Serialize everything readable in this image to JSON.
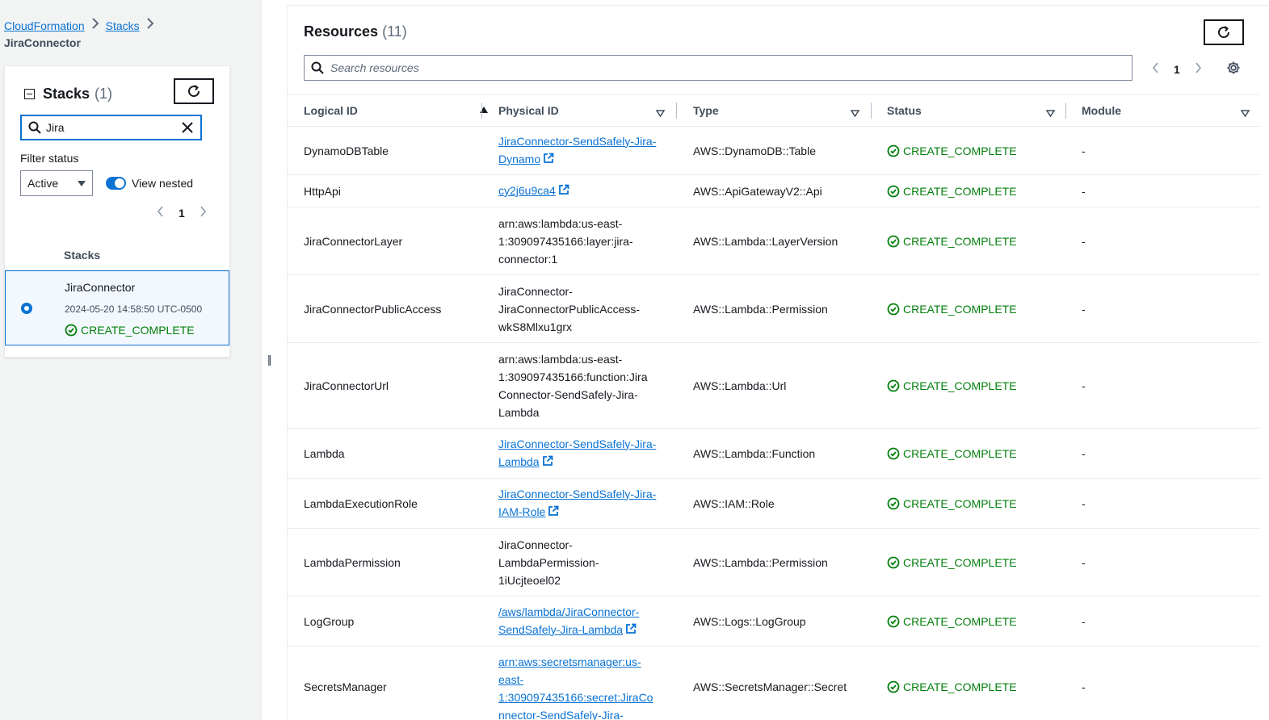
{
  "breadcrumb": {
    "root": "CloudFormation",
    "stacks": "Stacks",
    "current": "JiraConnector"
  },
  "stacks_panel": {
    "title": "Stacks",
    "count": "(1)",
    "search_value": "Jira",
    "filter_label": "Filter status",
    "filter_value": "Active",
    "toggle_label": "View nested",
    "page": "1",
    "column_header": "Stacks",
    "stack": {
      "name": "JiraConnector",
      "date": "2024-05-20 14:58:50 UTC-0500",
      "status": "CREATE_COMPLETE"
    }
  },
  "resources": {
    "title": "Resources",
    "count": "(11)",
    "search_placeholder": "Search resources",
    "page": "1",
    "columns": [
      "Logical ID",
      "Physical ID",
      "Type",
      "Status",
      "Module"
    ],
    "rows": [
      {
        "logical": "DynamoDBTable",
        "physical": [
          "JiraConnector-SendSafely-Jira-",
          "Dynamo"
        ],
        "link": true,
        "type": "AWS::DynamoDB::Table",
        "status": "CREATE_COMPLETE",
        "module": "-"
      },
      {
        "logical": "HttpApi",
        "physical": [
          "cy2j6u9ca4"
        ],
        "link": true,
        "type": "AWS::ApiGatewayV2::Api",
        "status": "CREATE_COMPLETE",
        "module": "-"
      },
      {
        "logical": "JiraConnectorLayer",
        "physical": [
          "arn:aws:lambda:us-east-",
          "1:309097435166:layer:jira-",
          "connector:1"
        ],
        "link": false,
        "type": "AWS::Lambda::LayerVersion",
        "status": "CREATE_COMPLETE",
        "module": "-"
      },
      {
        "logical": "JiraConnectorPublicAccess",
        "physical": [
          "JiraConnector-",
          "JiraConnectorPublicAccess-",
          "wkS8Mlxu1grx"
        ],
        "link": false,
        "type": "AWS::Lambda::Permission",
        "status": "CREATE_COMPLETE",
        "module": "-"
      },
      {
        "logical": "JiraConnectorUrl",
        "physical": [
          "arn:aws:lambda:us-east-",
          "1:309097435166:function:Jira",
          "Connector-SendSafely-Jira-",
          "Lambda"
        ],
        "link": false,
        "type": "AWS::Lambda::Url",
        "status": "CREATE_COMPLETE",
        "module": "-"
      },
      {
        "logical": "Lambda",
        "physical": [
          "JiraConnector-SendSafely-Jira-",
          "Lambda"
        ],
        "link": true,
        "type": "AWS::Lambda::Function",
        "status": "CREATE_COMPLETE",
        "module": "-"
      },
      {
        "logical": "LambdaExecutionRole",
        "physical": [
          "JiraConnector-SendSafely-Jira-",
          "IAM-Role"
        ],
        "link": true,
        "type": "AWS::IAM::Role",
        "status": "CREATE_COMPLETE",
        "module": "-"
      },
      {
        "logical": "LambdaPermission",
        "physical": [
          "JiraConnector-",
          "LambdaPermission-",
          "1iUcjteoel02"
        ],
        "link": false,
        "type": "AWS::Lambda::Permission",
        "status": "CREATE_COMPLETE",
        "module": "-"
      },
      {
        "logical": "LogGroup",
        "physical": [
          "/aws/lambda/JiraConnector-",
          "SendSafely-Jira-Lambda"
        ],
        "link": true,
        "type": "AWS::Logs::LogGroup",
        "status": "CREATE_COMPLETE",
        "module": "-"
      },
      {
        "logical": "SecretsManager",
        "physical": [
          "arn:aws:secretsmanager:us-",
          "east-",
          "1:309097435166:secret:JiraCo",
          "nnector-SendSafely-Jira-"
        ],
        "link": true,
        "type": "AWS::SecretsManager::Secret",
        "status": "CREATE_COMPLETE",
        "module": "-"
      }
    ]
  }
}
